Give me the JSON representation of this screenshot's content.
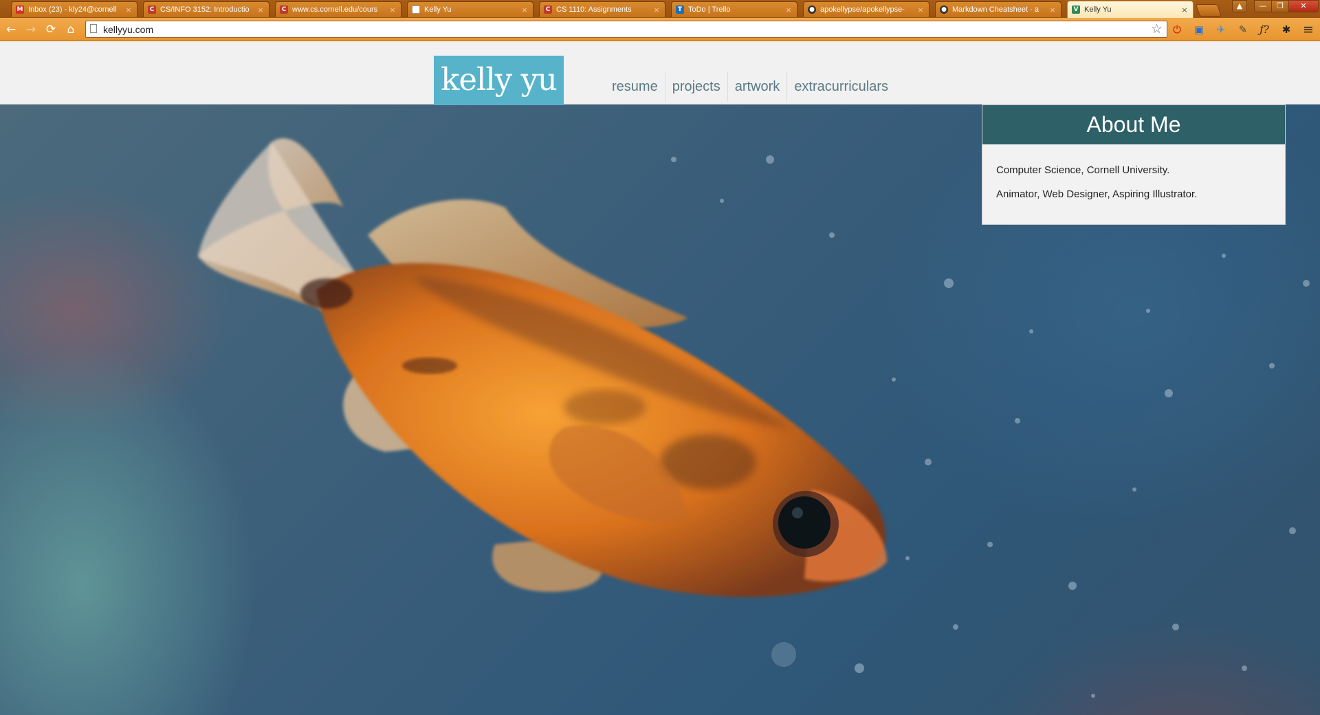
{
  "browser": {
    "tabs": [
      {
        "title": "Inbox (23) - kly24@cornell",
        "favicon": "gmail-icon",
        "color": "#d93025",
        "glyph": "M"
      },
      {
        "title": "CS/INFO 3152: Introductio",
        "favicon": "cornell-icon",
        "color": "#c0392b",
        "glyph": "C"
      },
      {
        "title": "www.cs.cornell.edu/cours",
        "favicon": "cornell-icon",
        "color": "#c0392b",
        "glyph": "C"
      },
      {
        "title": "Kelly Yu",
        "favicon": "page-icon",
        "color": "#ffffff",
        "glyph": ""
      },
      {
        "title": "CS 1110: Assignments",
        "favicon": "cornell-icon",
        "color": "#c0392b",
        "glyph": "C"
      },
      {
        "title": "ToDo | Trello",
        "favicon": "trello-icon",
        "color": "#1d6fb8",
        "glyph": "T"
      },
      {
        "title": "apokellypse/apokellypse-",
        "favicon": "github-icon",
        "color": "#333333",
        "glyph": "●"
      },
      {
        "title": "Markdown Cheatsheet · a",
        "favicon": "github-icon",
        "color": "#333333",
        "glyph": "●"
      },
      {
        "title": "Kelly Yu",
        "favicon": "vine-icon",
        "color": "#2e8b57",
        "glyph": "V"
      }
    ],
    "close_glyph": "×",
    "url": "kellyyu.com",
    "controls": {
      "back": "←",
      "forward": "→",
      "reload": "⟳",
      "home": "⌂",
      "star": "☆",
      "minimize": "—",
      "maximize": "❐",
      "close": "✕",
      "user": "▲"
    },
    "extensions": [
      {
        "name": "adblock-icon",
        "glyph": "⏻",
        "color": "#d01010"
      },
      {
        "name": "window-icon",
        "glyph": "▣",
        "color": "#2a6fd0"
      },
      {
        "name": "bird-icon",
        "glyph": "✈",
        "color": "#3a8fe0"
      },
      {
        "name": "eyedropper-icon",
        "glyph": "✎",
        "color": "#444444"
      },
      {
        "name": "font-icon",
        "glyph": "ƒ?",
        "color": "#222222"
      },
      {
        "name": "gear-icon",
        "glyph": "✱",
        "color": "#222222"
      },
      {
        "name": "menu-icon",
        "glyph": "≡",
        "color": "#222222"
      }
    ]
  },
  "site": {
    "logo": "kelly yu",
    "nav": [
      "resume",
      "projects",
      "artwork",
      "extracurriculars"
    ],
    "about": {
      "title": "About Me",
      "lines": [
        "Computer Science, Cornell University.",
        "Animator, Web Designer, Aspiring Illustrator."
      ]
    },
    "colors": {
      "logo": "#56b3c9",
      "about_header": "#2e6068",
      "chrome": "#e8952e"
    }
  }
}
